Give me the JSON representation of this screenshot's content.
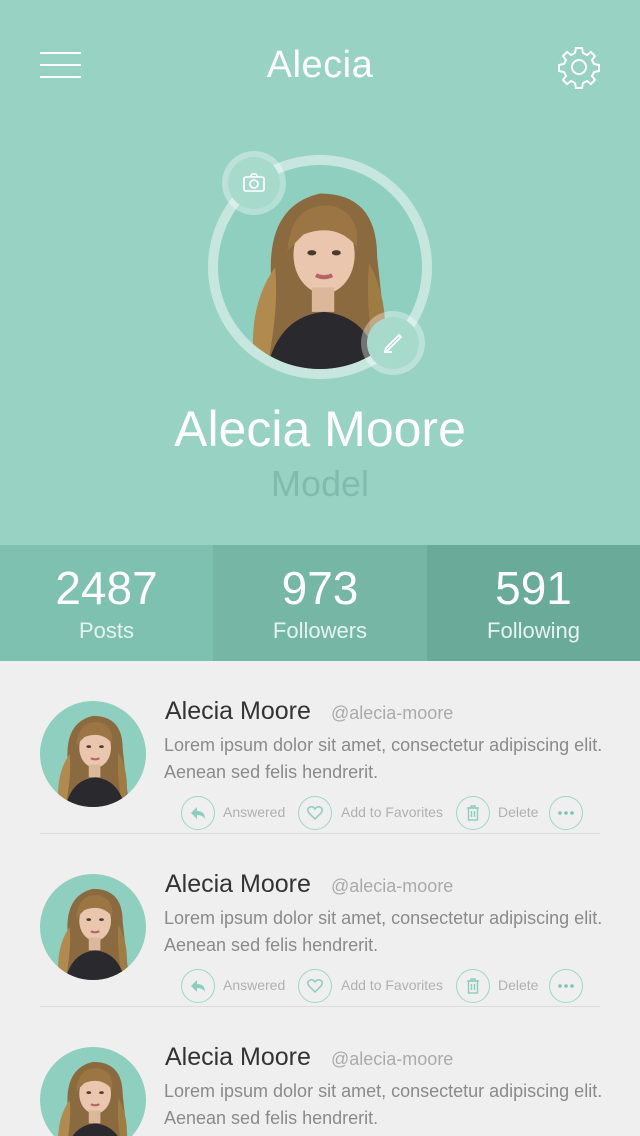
{
  "header": {
    "title": "Alecia",
    "menu_icon": "hamburger-menu-icon",
    "settings_icon": "gear-icon",
    "background": "#98d2c3"
  },
  "profile": {
    "name": "Alecia Moore",
    "role": "Model",
    "camera_icon": "camera-icon",
    "edit_icon": "pencil-icon"
  },
  "stats": [
    {
      "value": "2487",
      "label": "Posts"
    },
    {
      "value": "973",
      "label": "Followers"
    },
    {
      "value": "591",
      "label": "Following"
    }
  ],
  "posts": [
    {
      "name": "Alecia Moore",
      "handle": "@alecia-moore",
      "text": "Lorem ipsum dolor sit amet, consectetur adipiscing elit.Aenean sed felis hendrerit.",
      "actions": {
        "answered": "Answered",
        "favorites": "Add to Favorites",
        "delete": "Delete"
      }
    },
    {
      "name": "Alecia Moore",
      "handle": "@alecia-moore",
      "text": "Lorem ipsum dolor sit amet, consectetur adipiscing elit.Aenean sed felis hendrerit.",
      "actions": {
        "answered": "Answered",
        "favorites": "Add to Favorites",
        "delete": "Delete"
      }
    },
    {
      "name": "Alecia Moore",
      "handle": "@alecia-moore",
      "text": "Lorem ipsum dolor sit amet, consectetur adipiscing elit.Aenean sed felis hendrerit."
    }
  ],
  "colors": {
    "accent": "#98d2c3",
    "stat_1": "#7fc1b0",
    "stat_2": "#76b6a5",
    "stat_3": "#6aaa99",
    "action_ring": "#9fd6c7"
  }
}
